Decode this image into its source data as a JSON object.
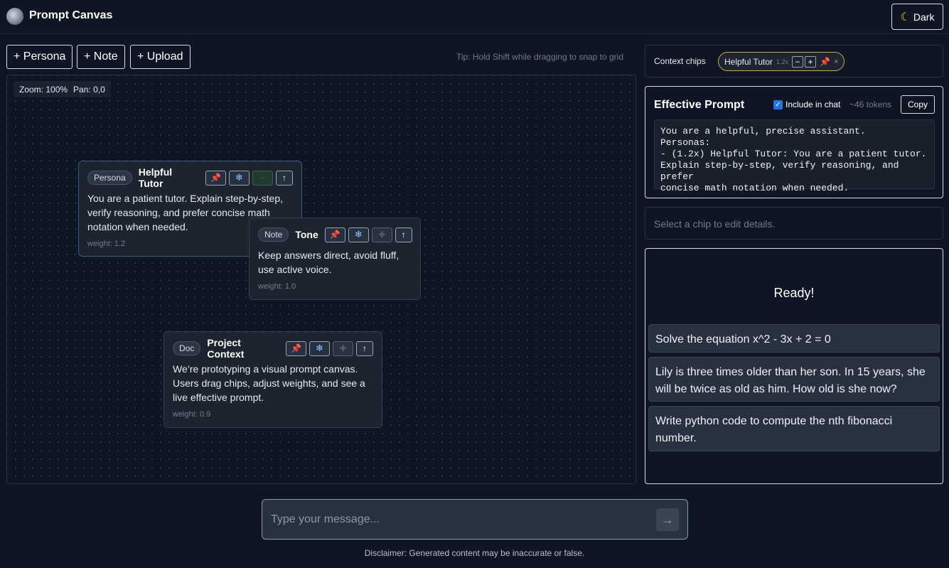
{
  "app": {
    "title": "Prompt Canvas"
  },
  "theme": {
    "label": "Dark",
    "icon": "moon-icon"
  },
  "toolbar": {
    "add_persona": "+ Persona",
    "add_note": "+ Note",
    "add_upload": "+ Upload",
    "tip": "Tip: Hold Shift while dragging to snap to grid"
  },
  "canvas": {
    "zoom": "Zoom: 100%",
    "pan": "Pan: 0,0",
    "cards": [
      {
        "tag": "Persona",
        "title": "Helpful Tutor",
        "body": "You are a patient tutor. Explain step-by-step, verify reasoning, and prefer concise math notation when needed.",
        "weight": "weight: 1.2"
      },
      {
        "tag": "Note",
        "title": "Tone",
        "body": "Keep answers direct, avoid fluff, use active voice.",
        "weight": "weight: 1.0"
      },
      {
        "tag": "Doc",
        "title": "Project Context",
        "body": "We’re prototyping a visual prompt canvas. Users drag chips, adjust weights, and see a live effective prompt.",
        "weight": "weight: 0.9"
      }
    ]
  },
  "context": {
    "label": "Context chips",
    "chip": {
      "name": "Helpful Tutor",
      "weight": "1.2x",
      "minus": "−",
      "plus": "+",
      "remove": "×"
    }
  },
  "prompt": {
    "title": "Effective Prompt",
    "include_label": "Include in chat",
    "include_checked": true,
    "tokens": "~46 tokens",
    "copy": "Copy",
    "text": "You are a helpful, precise assistant.\nPersonas:\n- (1.2x) Helpful Tutor: You are a patient tutor.\nExplain step-by-step, verify reasoning, and prefer\nconcise math notation when needed."
  },
  "details": {
    "placeholder": "Select a chip to edit details."
  },
  "chat": {
    "status": "Ready!",
    "suggestions": [
      "Solve the equation x^2 - 3x + 2 = 0",
      "Lily is three times older than her son. In 15 years, she will be twice as old as him. How old is she now?",
      "Write python code to compute the nth fibonacci number."
    ],
    "input_placeholder": "Type your message...",
    "disclaimer": "Disclaimer: Generated content may be inaccurate or false."
  },
  "colors": {
    "background": "#0f1623",
    "card": "#1c2430",
    "chip_border": "#d4a93c",
    "accent_blue": "#1f74e8",
    "pin_red": "#e04848"
  }
}
